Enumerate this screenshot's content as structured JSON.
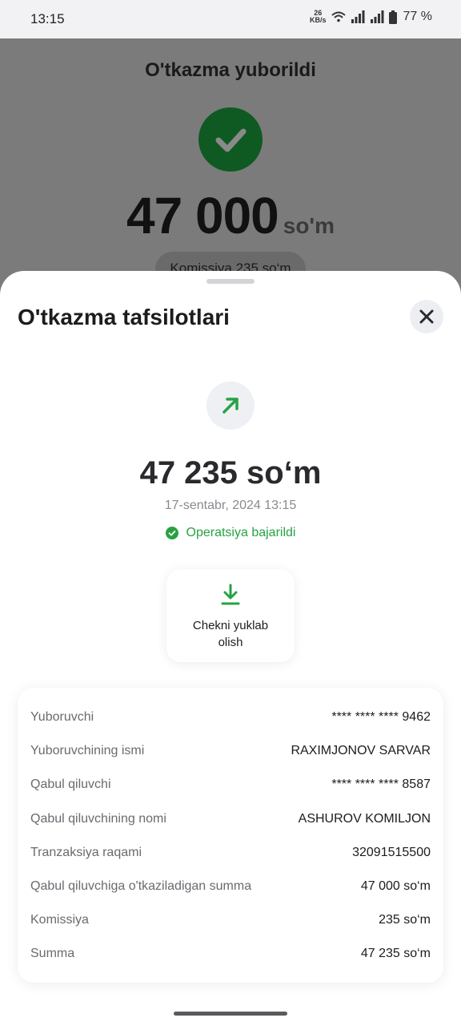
{
  "status_bar": {
    "time": "13:15",
    "net_speed": "26",
    "net_unit": "KB/s",
    "battery": "77 %"
  },
  "background": {
    "title": "O'tkazma yuborildi",
    "amount": "47 000",
    "currency": "so'm",
    "commission_pill": "Komissiya 235 so‘m"
  },
  "sheet": {
    "title": "O'tkazma tafsilotlari",
    "amount": "47 235 so‘m",
    "datetime": "17-sentabr, 2024 13:15",
    "status_text": "Operatsiya bajarildi",
    "download_label_1": "Chekni yuklab",
    "download_label_2": "olish",
    "details": [
      {
        "label": "Yuboruvchi",
        "value": "**** **** **** 9462"
      },
      {
        "label": "Yuboruvchining ismi",
        "value": "RAXIMJONOV SARVAR"
      },
      {
        "label": "Qabul qiluvchi",
        "value": "**** **** **** 8587"
      },
      {
        "label": "Qabul qiluvchining nomi",
        "value": "ASHUROV KOMILJON"
      },
      {
        "label": "Tranzaksiya raqami",
        "value": "32091515500"
      },
      {
        "label": "Qabul qiluvchiga o'tkaziladigan summa",
        "value": "47 000 so‘m"
      },
      {
        "label": "Komissiya",
        "value": "235 so‘m"
      },
      {
        "label": "Summa",
        "value": "47 235 so‘m"
      }
    ]
  },
  "colors": {
    "accent_green": "#27a243",
    "dark_green": "#0f5a22",
    "overlay": "#7b7b7b"
  },
  "icons": [
    "wifi-icon",
    "signal-icon",
    "battery-icon",
    "check-icon",
    "close-icon",
    "arrow-up-right-icon",
    "check-circle-icon",
    "download-icon"
  ]
}
